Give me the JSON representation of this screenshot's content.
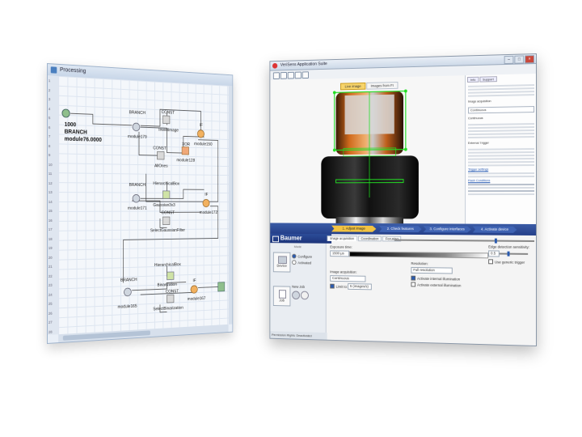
{
  "processing": {
    "title": "Processing",
    "main_node": {
      "id": "1000",
      "type": "BRANCH",
      "name": "module76.0000"
    },
    "nodes": [
      {
        "top": "BRANCH",
        "bottom": "module179"
      },
      {
        "top": "CONST",
        "bottom": "InvertImage"
      },
      {
        "top": "IF",
        "bottom": "module150"
      },
      {
        "top": "XOR",
        "bottom": "module128"
      },
      {
        "top": "CONST",
        "bottom": "AllOnes"
      },
      {
        "top": "BRANCH",
        "bottom": "module171"
      },
      {
        "top": "HierarchicalBox",
        "bottom": "Gaussian3x3"
      },
      {
        "top": "CONST",
        "bottom": "SelectGaussianFilter"
      },
      {
        "top": "IF",
        "bottom": "module172"
      },
      {
        "top": "HierarchicalBox",
        "bottom": "Binarization"
      },
      {
        "top": "CONST",
        "bottom": "SelectBinarization"
      },
      {
        "top": "IF",
        "bottom": "module167"
      },
      {
        "top": "BRANCH",
        "bottom": "module165"
      }
    ],
    "line_numbers": [
      "1",
      "2",
      "3",
      "4",
      "5",
      "6",
      "7",
      "8",
      "9",
      "10",
      "11",
      "12",
      "13",
      "14",
      "15",
      "16",
      "17",
      "18",
      "19",
      "20",
      "21",
      "22",
      "23",
      "24",
      "25",
      "26",
      "27",
      "28"
    ]
  },
  "app": {
    "title": "VeriSens Application Suite",
    "image_tabs": [
      "Live image",
      "Images from FI"
    ],
    "right_tabs": [
      "Info",
      "Support"
    ],
    "right_panel": {
      "field1_label": "Image acquisition",
      "field1_value": "Continuous",
      "para_title": "Continuous",
      "para2_title": "External Trigger",
      "links": [
        "Trigger settings",
        "Flash Conditions"
      ]
    },
    "wizard_steps": [
      "1. Adjust image",
      "2. Check features",
      "3. Configure interfaces",
      "4. Activate device"
    ],
    "brand": "Baumer",
    "sidebar": {
      "header": "Mode",
      "configure": "Configure",
      "activated": "Activated",
      "device_label": "Device",
      "job_label": "Job",
      "new_job": "New Job",
      "status_left": "Permission Rights",
      "status_right": "Deactivated"
    },
    "settings": {
      "subtabs": [
        "Image acquisition",
        "Coordination",
        "Focusing"
      ],
      "exposure_label": "Exposure time:",
      "exposure_value": "1500 µs",
      "resolution_label": "Resolution:",
      "resolution_value": "Full resolution",
      "image_acq_label": "Image acquisition:",
      "image_acq_value": "Continuous",
      "limit_label": "Limit to:",
      "limit_value": "5 (images/s)",
      "internal_illum": "Activate internal illumination",
      "external_illum": "Activate external illumination",
      "edge_label": "Edge detection sensitivity:",
      "edge_value": "0.5",
      "trigger_label": "Use generic trigger"
    }
  }
}
